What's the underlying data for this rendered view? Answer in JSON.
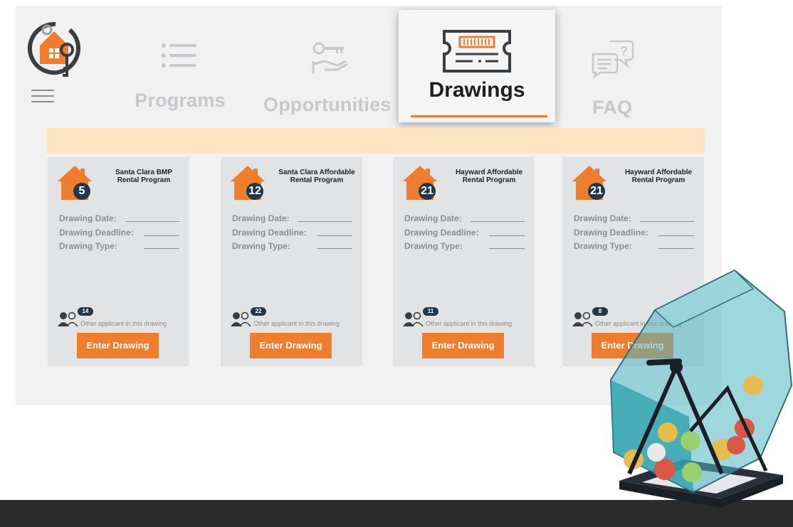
{
  "nav": {
    "programs": "Programs",
    "opportunities": "Opportunities",
    "drawings": "Drawings",
    "faq": "FAQ",
    "active": "Drawings"
  },
  "colors": {
    "accent": "#ef7d2e",
    "badge": "#23374a",
    "banner": "#fde4c2",
    "panel": "#f1f1f2",
    "card": "#e2e3e5",
    "footer": "#2b2b2b"
  },
  "icons": {
    "logo": "house-key-logo-icon",
    "menu": "hamburger-menu-icon",
    "programs": "list-icon",
    "opportunities": "key-hand-icon",
    "drawings": "ticket-icon",
    "faq": "chat-question-icon"
  },
  "cards": [
    {
      "count": "5",
      "title_line1": "Santa Clara BMP",
      "title_line2": "Rental Program",
      "applicants": "14"
    },
    {
      "count": "12",
      "title_line1": "Santa Clara Affordable",
      "title_line2": "Rental Program",
      "applicants": "22"
    },
    {
      "count": "21",
      "title_line1": "Hayward Affordable",
      "title_line2": "Rental Program",
      "applicants": "11"
    },
    {
      "count": "21",
      "title_line1": "Hayward Affordable",
      "title_line2": "Rental Program",
      "applicants": "8"
    }
  ],
  "card_labels": {
    "drawing_date": "Drawing Date:",
    "drawing_deadline": "Drawing Deadline:",
    "drawing_type": "Drawing Type:",
    "applicant_text": "Other applicant in this drawing",
    "enter_button": "Enter Drawing"
  }
}
